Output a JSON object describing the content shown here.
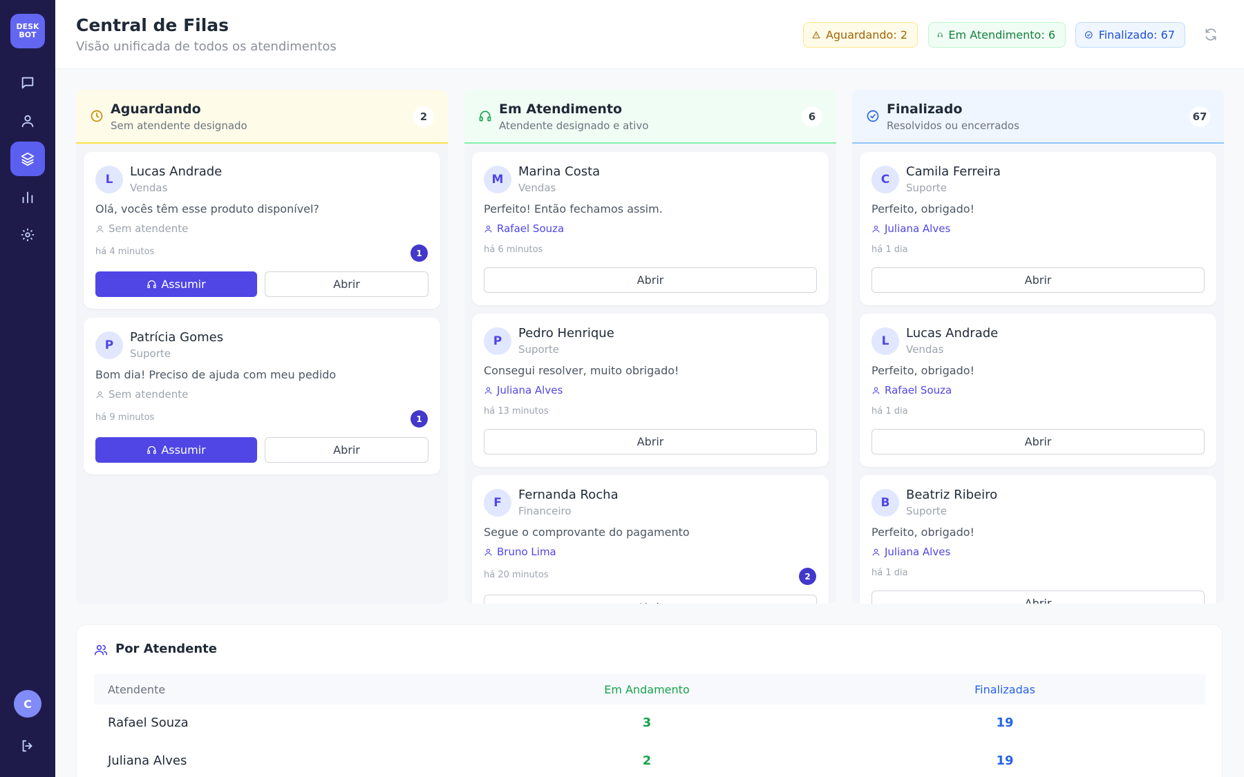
{
  "app": {
    "logo_line1": "DESK",
    "logo_line2": "BOT",
    "user_initial": "C"
  },
  "sidebar": {
    "items": [
      {
        "name": "chat",
        "icon": "chat-icon"
      },
      {
        "name": "contacts",
        "icon": "user-icon"
      },
      {
        "name": "queues",
        "icon": "layers-icon",
        "active": true
      },
      {
        "name": "reports",
        "icon": "bar-chart-icon"
      },
      {
        "name": "settings",
        "icon": "gear-icon"
      }
    ],
    "logout_icon": "logout-icon"
  },
  "header": {
    "title": "Central de Filas",
    "subtitle": "Visão unificada de todos os atendimentos",
    "pills": {
      "waiting": "Aguardando: 2",
      "attending": "Em Atendimento: 6",
      "finished": "Finalizado: 67"
    }
  },
  "columns": {
    "waiting": {
      "title": "Aguardando",
      "subtitle": "Sem atendente designado",
      "count": "2",
      "cards": [
        {
          "initial": "L",
          "name": "Lucas Andrade",
          "dept": "Vendas",
          "message": "Olá, vocês têm esse produto disponível?",
          "agent": "Sem atendente",
          "time": "há 4 minutos",
          "badge": "1",
          "assume_label": "Assumir",
          "open_label": "Abrir"
        },
        {
          "initial": "P",
          "name": "Patrícia Gomes",
          "dept": "Suporte",
          "message": "Bom dia! Preciso de ajuda com meu pedido",
          "agent": "Sem atendente",
          "time": "há 9 minutos",
          "badge": "1",
          "assume_label": "Assumir",
          "open_label": "Abrir"
        }
      ]
    },
    "attending": {
      "title": "Em Atendimento",
      "subtitle": "Atendente designado e ativo",
      "count": "6",
      "cards": [
        {
          "initial": "M",
          "name": "Marina Costa",
          "dept": "Vendas",
          "message": "Perfeito! Então fechamos assim.",
          "agent": "Rafael Souza",
          "time": "há 6 minutos",
          "open_label": "Abrir"
        },
        {
          "initial": "P",
          "name": "Pedro Henrique",
          "dept": "Suporte",
          "message": "Consegui resolver, muito obrigado!",
          "agent": "Juliana Alves",
          "time": "há 13 minutos",
          "open_label": "Abrir"
        },
        {
          "initial": "F",
          "name": "Fernanda Rocha",
          "dept": "Financeiro",
          "message": "Segue o comprovante do pagamento",
          "agent": "Bruno Lima",
          "time": "há 20 minutos",
          "badge": "2",
          "open_label": "Abrir"
        }
      ]
    },
    "finished": {
      "title": "Finalizado",
      "subtitle": "Resolvidos ou encerrados",
      "count": "67",
      "cards": [
        {
          "initial": "C",
          "name": "Camila Ferreira",
          "dept": "Suporte",
          "message": "Perfeito, obrigado!",
          "agent": "Juliana Alves",
          "time": "há 1 dia",
          "open_label": "Abrir"
        },
        {
          "initial": "L",
          "name": "Lucas Andrade",
          "dept": "Vendas",
          "message": "Perfeito, obrigado!",
          "agent": "Rafael Souza",
          "time": "há 1 dia",
          "open_label": "Abrir"
        },
        {
          "initial": "B",
          "name": "Beatriz Ribeiro",
          "dept": "Suporte",
          "message": "Perfeito, obrigado!",
          "agent": "Juliana Alves",
          "time": "há 1 dia",
          "open_label": "Abrir"
        }
      ]
    }
  },
  "agents_table": {
    "title": "Por Atendente",
    "headers": {
      "name": "Atendente",
      "in_progress": "Em Andamento",
      "finished": "Finalizadas"
    },
    "rows": [
      {
        "name": "Rafael Souza",
        "in_progress": "3",
        "finished": "19"
      },
      {
        "name": "Juliana Alves",
        "in_progress": "2",
        "finished": "19"
      }
    ]
  },
  "colors": {
    "sidebar_bg": "#1e1b4b",
    "accent": "#4f46e5",
    "waiting": "#ca8a04",
    "attending": "#16a34a",
    "finished": "#2563eb"
  }
}
